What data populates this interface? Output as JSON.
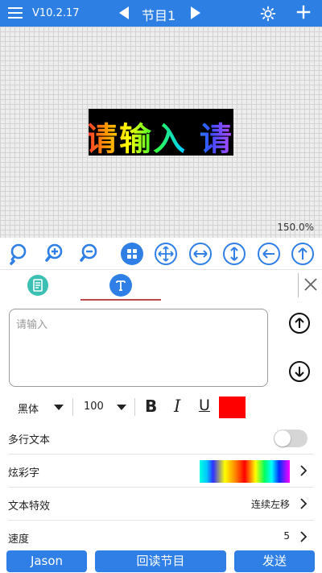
{
  "topbar": {
    "version": "V10.2.17",
    "title": "节目1"
  },
  "canvas": {
    "led_text": "请输入 请输入",
    "zoom": "150.0%"
  },
  "toolbar": {
    "icons": [
      "search-icon",
      "zoom-in-icon",
      "zoom-out-icon",
      "grid-icon",
      "move-icon",
      "horizontal-arrows-icon",
      "vertical-arrows-icon",
      "arrow-left-icon",
      "arrow-up-icon"
    ]
  },
  "editor": {
    "placeholder": "请输入",
    "font": "黑体",
    "font_size": "100",
    "bold": "B",
    "italic": "I",
    "underline": "U",
    "text_color": "#ff0000"
  },
  "settings": {
    "multiline": {
      "label": "多行文本",
      "enabled": false
    },
    "colorful": {
      "label": "炫彩字"
    },
    "effect": {
      "label": "文本特效",
      "value": "连续左移"
    },
    "speed": {
      "label": "速度",
      "value": "5"
    }
  },
  "buttons": {
    "user": "Jason",
    "readback": "回读节目",
    "send": "发送"
  },
  "colors": {
    "primary": "#2e7fe4",
    "tab_underline": "#c0474a",
    "doc_tab": "#3cc0b4"
  }
}
